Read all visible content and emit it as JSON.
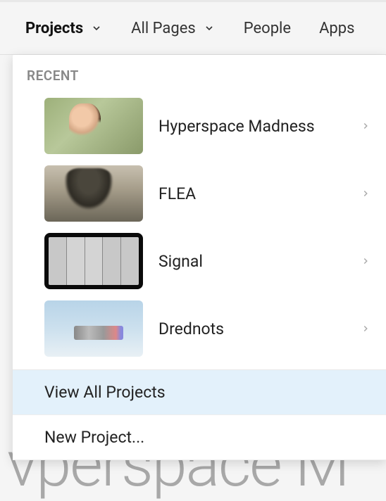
{
  "nav": {
    "projects": "Projects",
    "allPages": "All Pages",
    "people": "People",
    "apps": "Apps"
  },
  "dropdown": {
    "recentLabel": "RECENT",
    "projects": [
      {
        "name": "Hyperspace Madness"
      },
      {
        "name": "FLEA"
      },
      {
        "name": "Signal"
      },
      {
        "name": "Drednots"
      }
    ],
    "viewAll": "View All Projects",
    "newProject": "New Project..."
  },
  "bgText": "vperspace M"
}
